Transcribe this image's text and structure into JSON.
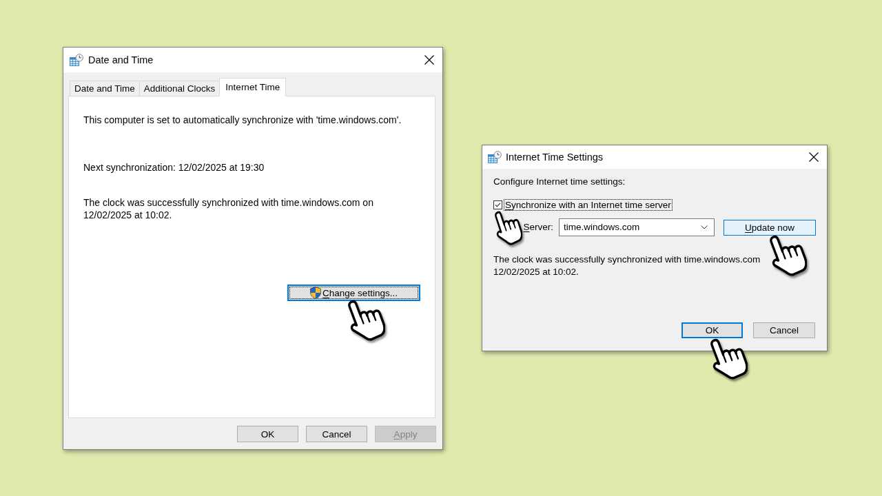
{
  "date_time_dialog": {
    "title": "Date and Time",
    "tabs": [
      {
        "label": "Date and Time",
        "selected": false
      },
      {
        "label": "Additional Clocks",
        "selected": false
      },
      {
        "label": "Internet Time",
        "selected": true
      }
    ],
    "messages": [
      "This computer is set to automatically synchronize with 'time.windows.com'.",
      "Next synchronization: 12/02/2025 at 19:30",
      "The clock was successfully synchronized with time.windows.com on 12/02/2025 at 10:02."
    ],
    "change_settings_button": {
      "label": "Change settings...",
      "focused": true,
      "access_key_underlined": true
    },
    "buttons": [
      {
        "label": "OK",
        "disabled": false,
        "access_key_underlined": false
      },
      {
        "label": "Cancel",
        "disabled": false,
        "access_key_underlined": false
      },
      {
        "label": "Apply",
        "disabled": true,
        "access_key_underlined": true
      }
    ]
  },
  "internet_time_dialog": {
    "title": "Internet Time Settings",
    "heading": "Configure Internet time settings:",
    "sync_checkbox": {
      "label": "Synchronize with an Internet time server",
      "checked": true,
      "focused": true,
      "access_key_underlined": true
    },
    "server": {
      "label": "Server:",
      "access_key_underlined": true,
      "value": "time.windows.com"
    },
    "update_button": {
      "label": "Update now",
      "hovered": true,
      "access_key_underlined": true
    },
    "status": "The clock was successfully synchronized with time.windows.com 12/02/2025 at 10:02.",
    "buttons": [
      {
        "label": "OK",
        "default": true,
        "access_key_underlined": false
      },
      {
        "label": "Cancel",
        "default": false,
        "access_key_underlined": false
      }
    ]
  }
}
